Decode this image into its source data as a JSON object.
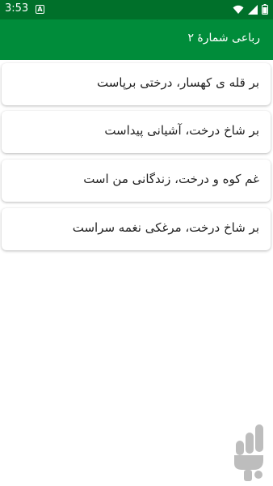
{
  "status_bar": {
    "time": "3:53",
    "notification_glyph": "A"
  },
  "app_bar": {
    "title": "رباعی شمارهٔ ۲"
  },
  "verses": [
    "بر قله ی کهسار، درختی برپاست",
    "بر شاخ درخت، آشیانی پیداست",
    "غم کوه و درخت، زندگانی من است",
    "بر شاخ درخت، مرغکی نغمه سراست"
  ],
  "colors": {
    "status_bar": "#00702a",
    "app_bar": "#008c3a",
    "title_text": "#ffffff"
  },
  "icons": [
    "wifi-icon",
    "signal-icon",
    "battery-icon",
    "app-logo-icon"
  ]
}
